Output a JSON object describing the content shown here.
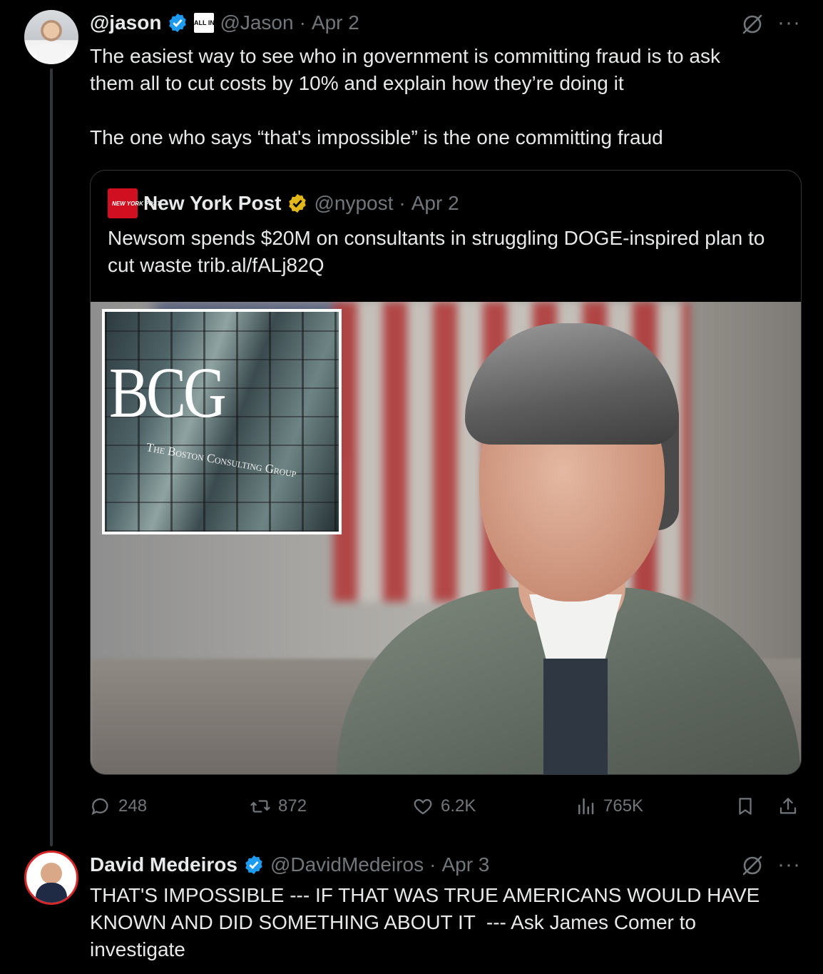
{
  "tweet1": {
    "name": "@jason",
    "badge_text": "ALL IN",
    "handle": "@Jason",
    "separator": "·",
    "date": "Apr 2",
    "text": "The easiest way to see who in government is committing fraud is to ask\nthem all to cut costs by 10% and explain how they’re doing it\n\nThe one who says “that's impossible” is the one committing fraud",
    "quote": {
      "logo_text": "NEW YORK POST",
      "name": "New York Post",
      "handle": "@nypost",
      "separator": "·",
      "date": "Apr 2",
      "text": "Newsom spends $20M on consultants in struggling DOGE-inspired plan to cut waste trib.al/fALj82Q",
      "inset_logo": "BCG",
      "inset_caption": "The Boston Consulting Group"
    },
    "actions": {
      "replies": "248",
      "reposts": "872",
      "likes": "6.2K",
      "views": "765K"
    }
  },
  "tweet2": {
    "name": "David Medeiros",
    "handle": "@DavidMedeiros",
    "separator": "·",
    "date": "Apr 3",
    "text": "THAT'S IMPOSSIBLE --- IF THAT WAS TRUE AMERICANS WOULD HAVE\nKNOWN AND DID SOMETHING ABOUT IT  --- Ask James Comer to\ninvestigate"
  },
  "icons": {
    "verified": "verified-badge-icon",
    "grok": "grok-icon",
    "more": "more-icon",
    "reply": "reply-icon",
    "repost": "repost-icon",
    "like": "like-icon",
    "views": "views-icon",
    "bookmark": "bookmark-icon",
    "share": "share-icon"
  },
  "colors": {
    "background": "#000000",
    "text": "#e7e9ea",
    "muted": "#71767b",
    "verified_blue": "#1d9bf0",
    "verified_gold": "#e2b719",
    "border": "#333639"
  }
}
